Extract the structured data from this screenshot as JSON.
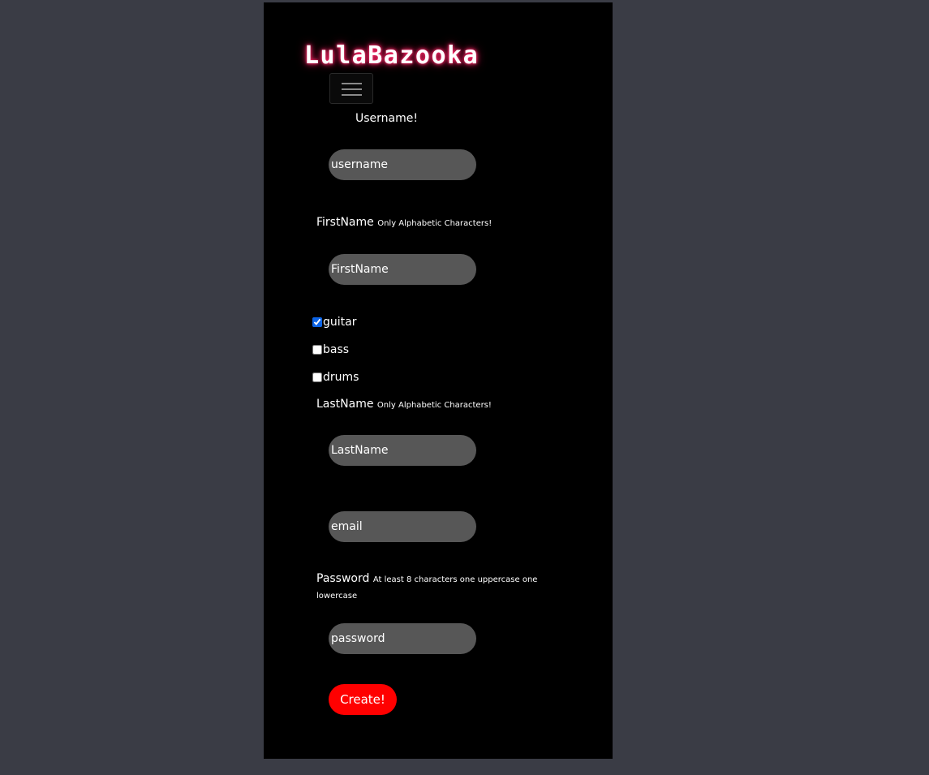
{
  "brand": {
    "name": "LulaBazooka",
    "glow_color": "#ff2a6a"
  },
  "navbar": {
    "toggler_icon": "hamburger-menu-icon"
  },
  "form": {
    "username": {
      "label": "Username!",
      "placeholder": "username"
    },
    "first_name": {
      "label": "FirstName",
      "hint": "Only Alphabetic Characters!",
      "placeholder": "FirstName"
    },
    "instruments": [
      {
        "label": "guitar",
        "checked": true
      },
      {
        "label": "bass",
        "checked": false
      },
      {
        "label": "drums",
        "checked": false
      }
    ],
    "last_name": {
      "label": "LastName",
      "hint": "Only Alphabetic Characters!",
      "placeholder": "LastName"
    },
    "email": {
      "placeholder": "email"
    },
    "password": {
      "label": "Password",
      "hint": "At least 8 characters one uppercase one lowercase",
      "placeholder": "password"
    },
    "submit_label": "Create!"
  },
  "colors": {
    "page_background": "#3a3c45",
    "app_background": "#000000",
    "input_background": "#575757",
    "submit_background": "#ff0000",
    "checkbox_accent": "#0b63e6"
  }
}
